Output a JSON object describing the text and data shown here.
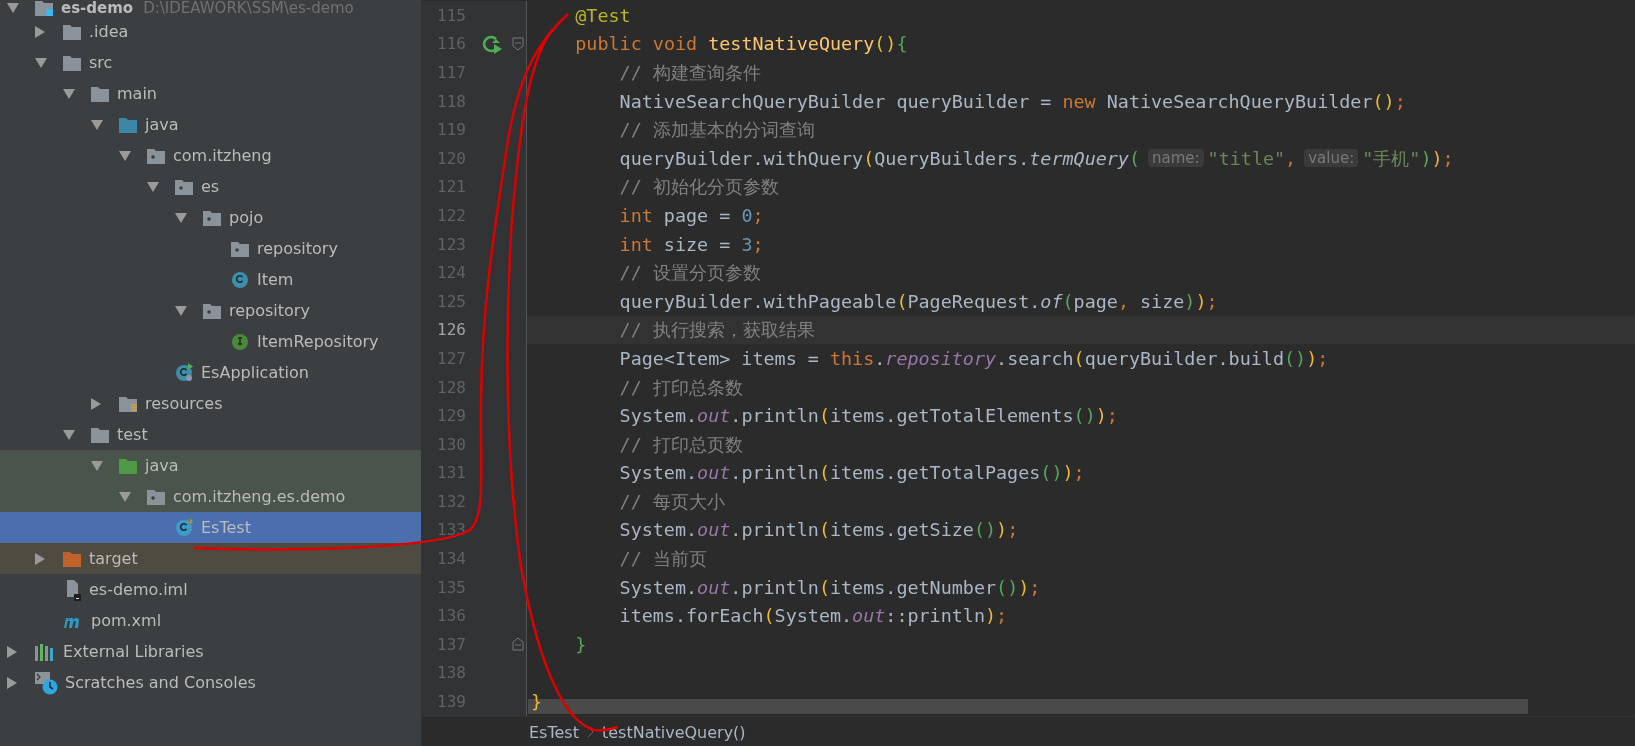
{
  "project_tree": [
    {
      "label": "es-demo",
      "path": "D:\\IDEAWORK\\SSM\\es-demo",
      "kind": "module",
      "expanded": true,
      "selected": false,
      "children": [
        {
          "label": ".idea",
          "kind": "folder",
          "expanded": false,
          "selected": false
        },
        {
          "label": "src",
          "kind": "folder",
          "expanded": true,
          "selected": false,
          "children": [
            {
              "label": "main",
              "kind": "folder",
              "expanded": true,
              "selected": false,
              "children": [
                {
                  "label": "java",
                  "kind": "sources",
                  "expanded": true,
                  "selected": false,
                  "children": [
                    {
                      "label": "com.itzheng",
                      "kind": "package",
                      "expanded": true,
                      "selected": false,
                      "children": [
                        {
                          "label": "es",
                          "kind": "package",
                          "expanded": true,
                          "selected": false,
                          "children": [
                            {
                              "label": "pojo",
                              "kind": "package",
                              "expanded": true,
                              "selected": false,
                              "children": [
                                {
                                  "label": "repository",
                                  "kind": "package",
                                  "selected": false
                                },
                                {
                                  "label": "Item",
                                  "kind": "class",
                                  "selected": false
                                }
                              ]
                            },
                            {
                              "label": "repository",
                              "kind": "package",
                              "expanded": true,
                              "selected": false,
                              "children": [
                                {
                                  "label": "ItemRepository",
                                  "kind": "interface",
                                  "selected": false
                                }
                              ]
                            }
                          ]
                        },
                        {
                          "label": "EsApplication",
                          "kind": "application",
                          "selected": false
                        }
                      ]
                    }
                  ]
                },
                {
                  "label": "resources",
                  "kind": "resources",
                  "expanded": false,
                  "selected": false
                }
              ]
            },
            {
              "label": "test",
              "kind": "folder",
              "expanded": true,
              "selected": false,
              "children": [
                {
                  "label": "java",
                  "kind": "tests",
                  "test_scope": true,
                  "expanded": true,
                  "selected": false,
                  "children": [
                    {
                      "label": "com.itzheng.es.demo",
                      "kind": "package",
                      "test_scope": true,
                      "expanded": true,
                      "selected": false,
                      "children": [
                        {
                          "label": "EsTest",
                          "kind": "testclass",
                          "selected": true
                        }
                      ]
                    }
                  ]
                }
              ]
            }
          ]
        },
        {
          "label": "target",
          "kind": "excluded",
          "excluded": true,
          "expanded": false,
          "selected": false
        },
        {
          "label": "es-demo.iml",
          "kind": "iml",
          "selected": false
        },
        {
          "label": "pom.xml",
          "kind": "maven",
          "selected": false
        }
      ]
    },
    {
      "label": "External Libraries",
      "kind": "libraries",
      "expanded": false,
      "selected": false
    },
    {
      "label": "Scratches and Consoles",
      "kind": "scratches",
      "expanded": false,
      "selected": false
    }
  ],
  "editor": {
    "lines": [
      {
        "number": "115",
        "tokens": [
          {
            "text": "    @Test",
            "kind": "annotation"
          }
        ]
      },
      {
        "number": "116",
        "run_marker": true,
        "fold_start": true,
        "tokens": [
          {
            "text": "    public",
            "kind": "keyword"
          },
          {
            "text": " void",
            "kind": "keyword"
          },
          {
            "text": " testNativeQuery",
            "kind": "method"
          },
          {
            "text": "()",
            "kind": "paren1"
          },
          {
            "text": "{",
            "kind": "paren2"
          }
        ]
      },
      {
        "number": "117",
        "tokens": [
          {
            "text": "        // 构建查询条件",
            "kind": "comment"
          }
        ]
      },
      {
        "number": "118",
        "tokens": [
          {
            "text": "        NativeSearchQueryBuilder queryBuilder = ",
            "kind": "plain"
          },
          {
            "text": "new",
            "kind": "keyword"
          },
          {
            "text": " NativeSearchQueryBuilder",
            "kind": "plain"
          },
          {
            "text": "()",
            "kind": "paren1"
          },
          {
            "text": ";",
            "kind": "punct"
          }
        ]
      },
      {
        "number": "119",
        "tokens": [
          {
            "text": "        // 添加基本的分词查询",
            "kind": "comment"
          }
        ]
      },
      {
        "number": "120",
        "tokens": [
          {
            "text": "        queryBuilder.withQuery",
            "kind": "plain"
          },
          {
            "text": "(",
            "kind": "paren1"
          },
          {
            "text": "QueryBuilders.",
            "kind": "plain"
          },
          {
            "text": "termQuery",
            "kind": "static"
          },
          {
            "text": "(",
            "kind": "paren2"
          },
          {
            "text": "name:",
            "kind": "hint"
          },
          {
            "text": "\"title\"",
            "kind": "string"
          },
          {
            "text": ",",
            "kind": "punct"
          },
          {
            "text": "value:",
            "kind": "hint"
          },
          {
            "text": "\"手机\"",
            "kind": "string"
          },
          {
            "text": ")",
            "kind": "paren2"
          },
          {
            "text": ")",
            "kind": "paren1"
          },
          {
            "text": ";",
            "kind": "punct"
          }
        ]
      },
      {
        "number": "121",
        "tokens": [
          {
            "text": "        // 初始化分页参数",
            "kind": "comment"
          }
        ]
      },
      {
        "number": "122",
        "tokens": [
          {
            "text": "        int",
            "kind": "keyword"
          },
          {
            "text": " page = ",
            "kind": "plain"
          },
          {
            "text": "0",
            "kind": "number"
          },
          {
            "text": ";",
            "kind": "punct"
          }
        ]
      },
      {
        "number": "123",
        "tokens": [
          {
            "text": "        int",
            "kind": "keyword"
          },
          {
            "text": " size = ",
            "kind": "plain"
          },
          {
            "text": "3",
            "kind": "number"
          },
          {
            "text": ";",
            "kind": "punct"
          }
        ]
      },
      {
        "number": "124",
        "tokens": [
          {
            "text": "        // 设置分页参数",
            "kind": "comment"
          }
        ]
      },
      {
        "number": "125",
        "tokens": [
          {
            "text": "        queryBuilder.withPageable",
            "kind": "plain"
          },
          {
            "text": "(",
            "kind": "paren1"
          },
          {
            "text": "PageRequest.",
            "kind": "plain"
          },
          {
            "text": "of",
            "kind": "static"
          },
          {
            "text": "(",
            "kind": "paren2"
          },
          {
            "text": "page",
            "kind": "plain"
          },
          {
            "text": ",",
            "kind": "punct"
          },
          {
            "text": " size",
            "kind": "plain"
          },
          {
            "text": ")",
            "kind": "paren2"
          },
          {
            "text": ")",
            "kind": "paren1"
          },
          {
            "text": ";",
            "kind": "punct"
          }
        ]
      },
      {
        "number": "126",
        "current": true,
        "tokens": [
          {
            "text": "        // 执行搜索，获取结果",
            "kind": "comment"
          }
        ]
      },
      {
        "number": "127",
        "tokens": [
          {
            "text": "        Page<Item> items = ",
            "kind": "plain"
          },
          {
            "text": "this",
            "kind": "keyword"
          },
          {
            "text": ".",
            "kind": "plain"
          },
          {
            "text": "repository",
            "kind": "field"
          },
          {
            "text": ".search",
            "kind": "plain"
          },
          {
            "text": "(",
            "kind": "paren1"
          },
          {
            "text": "queryBuilder.build",
            "kind": "plain"
          },
          {
            "text": "()",
            "kind": "paren2"
          },
          {
            "text": ")",
            "kind": "paren1"
          },
          {
            "text": ";",
            "kind": "punct"
          }
        ]
      },
      {
        "number": "128",
        "tokens": [
          {
            "text": "        // 打印总条数",
            "kind": "comment"
          }
        ]
      },
      {
        "number": "129",
        "tokens": [
          {
            "text": "        System.",
            "kind": "plain"
          },
          {
            "text": "out",
            "kind": "field"
          },
          {
            "text": ".println",
            "kind": "plain"
          },
          {
            "text": "(",
            "kind": "paren1"
          },
          {
            "text": "items.getTotalElements",
            "kind": "plain"
          },
          {
            "text": "()",
            "kind": "paren2"
          },
          {
            "text": ")",
            "kind": "paren1"
          },
          {
            "text": ";",
            "kind": "punct"
          }
        ]
      },
      {
        "number": "130",
        "tokens": [
          {
            "text": "        // 打印总页数",
            "kind": "comment"
          }
        ]
      },
      {
        "number": "131",
        "tokens": [
          {
            "text": "        System.",
            "kind": "plain"
          },
          {
            "text": "out",
            "kind": "field"
          },
          {
            "text": ".println",
            "kind": "plain"
          },
          {
            "text": "(",
            "kind": "paren1"
          },
          {
            "text": "items.getTotalPages",
            "kind": "plain"
          },
          {
            "text": "()",
            "kind": "paren2"
          },
          {
            "text": ")",
            "kind": "paren1"
          },
          {
            "text": ";",
            "kind": "punct"
          }
        ]
      },
      {
        "number": "132",
        "tokens": [
          {
            "text": "        // 每页大小",
            "kind": "comment"
          }
        ]
      },
      {
        "number": "133",
        "tokens": [
          {
            "text": "        System.",
            "kind": "plain"
          },
          {
            "text": "out",
            "kind": "field"
          },
          {
            "text": ".println",
            "kind": "plain"
          },
          {
            "text": "(",
            "kind": "paren1"
          },
          {
            "text": "items.getSize",
            "kind": "plain"
          },
          {
            "text": "()",
            "kind": "paren2"
          },
          {
            "text": ")",
            "kind": "paren1"
          },
          {
            "text": ";",
            "kind": "punct"
          }
        ]
      },
      {
        "number": "134",
        "tokens": [
          {
            "text": "        // 当前页",
            "kind": "comment"
          }
        ]
      },
      {
        "number": "135",
        "tokens": [
          {
            "text": "        System.",
            "kind": "plain"
          },
          {
            "text": "out",
            "kind": "field"
          },
          {
            "text": ".println",
            "kind": "plain"
          },
          {
            "text": "(",
            "kind": "paren1"
          },
          {
            "text": "items.getNumber",
            "kind": "plain"
          },
          {
            "text": "()",
            "kind": "paren2"
          },
          {
            "text": ")",
            "kind": "paren1"
          },
          {
            "text": ";",
            "kind": "punct"
          }
        ]
      },
      {
        "number": "136",
        "tokens": [
          {
            "text": "        items.forEach",
            "kind": "plain"
          },
          {
            "text": "(",
            "kind": "paren1"
          },
          {
            "text": "System.",
            "kind": "plain"
          },
          {
            "text": "out",
            "kind": "field"
          },
          {
            "text": "::println",
            "kind": "plain"
          },
          {
            "text": ")",
            "kind": "paren1"
          },
          {
            "text": ";",
            "kind": "punct"
          }
        ]
      },
      {
        "number": "137",
        "fold_end": true,
        "tokens": [
          {
            "text": "    }",
            "kind": "paren2"
          }
        ]
      },
      {
        "number": "138"
      },
      {
        "number": "139",
        "tokens": [
          {
            "text": "}",
            "kind": "paren1"
          }
        ]
      }
    ]
  },
  "breadcrumbs": [
    "EsTest",
    "testNativeQuery()"
  ]
}
